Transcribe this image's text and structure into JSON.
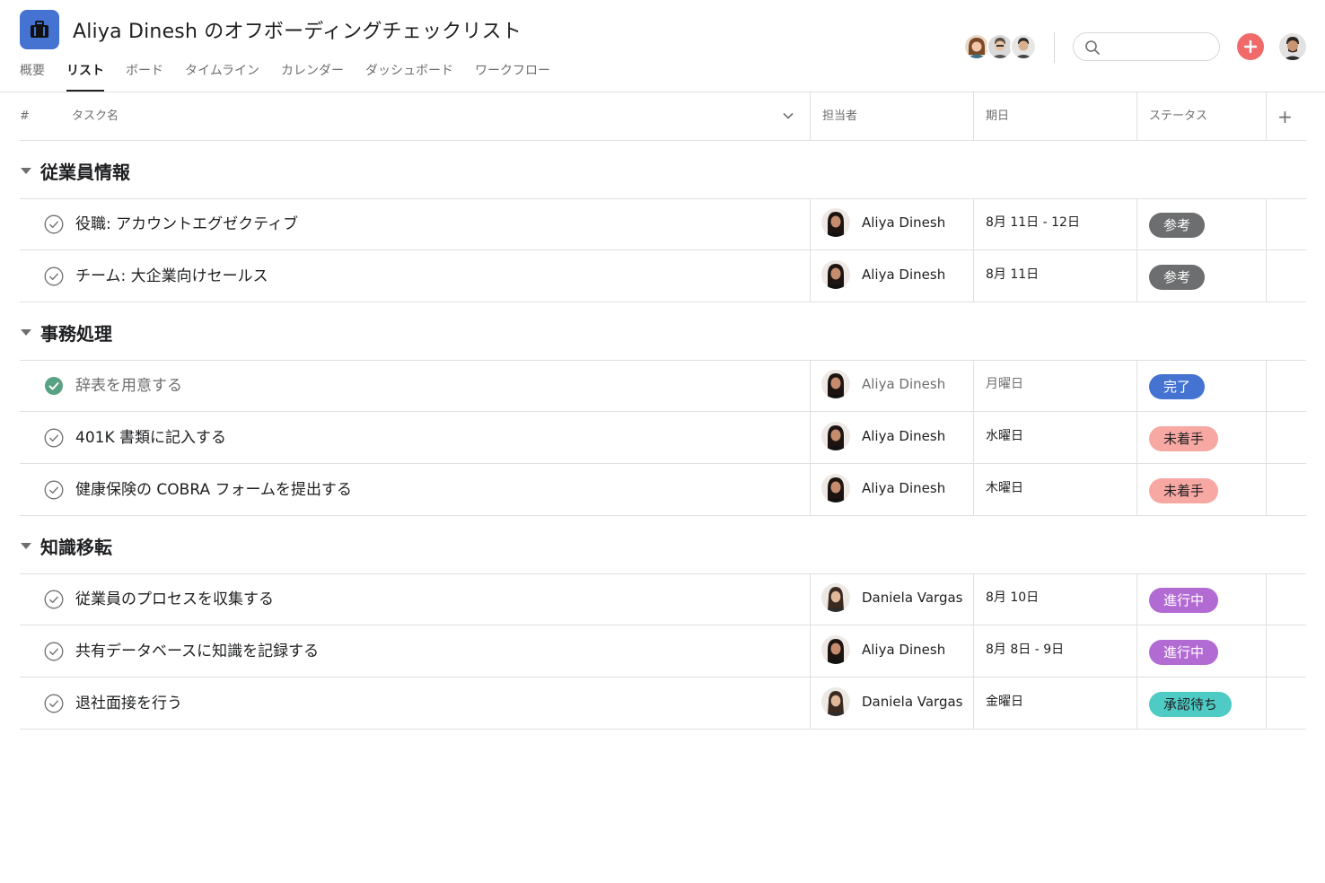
{
  "project": {
    "title": "Aliya Dinesh のオフボーディングチェックリスト",
    "icon": "briefcase-icon"
  },
  "tabs": [
    {
      "label": "概要",
      "active": false
    },
    {
      "label": "リスト",
      "active": true
    },
    {
      "label": "ボード",
      "active": false
    },
    {
      "label": "タイムライン",
      "active": false
    },
    {
      "label": "カレンダー",
      "active": false
    },
    {
      "label": "ダッシュボード",
      "active": false
    },
    {
      "label": "ワークフロー",
      "active": false
    }
  ],
  "header": {
    "search_placeholder": "",
    "add_icon": "plus-icon",
    "members_count": 3
  },
  "columns": {
    "index": "#",
    "task": "タスク名",
    "assignee": "担当者",
    "due": "期日",
    "status": "ステータス",
    "add": "+"
  },
  "sections": [
    {
      "title": "従業員情報",
      "tasks": [
        {
          "name": "役職: アカウントエグゼクティブ",
          "assignee": "Aliya Dinesh",
          "due": "8月 11日 - 12日",
          "status": "参考",
          "completed": false
        },
        {
          "name": "チーム: 大企業向けセールス",
          "assignee": "Aliya Dinesh",
          "due": "8月 11日",
          "status": "参考",
          "completed": false
        }
      ]
    },
    {
      "title": "事務処理",
      "tasks": [
        {
          "name": "辞表を用意する",
          "assignee": "Aliya Dinesh",
          "due": "月曜日",
          "status": "完了",
          "completed": true
        },
        {
          "name": "401K 書類に記入する",
          "assignee": "Aliya Dinesh",
          "due": "水曜日",
          "status": "未着手",
          "completed": false
        },
        {
          "name": "健康保険の COBRA フォームを提出する",
          "assignee": "Aliya Dinesh",
          "due": "木曜日",
          "status": "未着手",
          "completed": false
        }
      ]
    },
    {
      "title": "知識移転",
      "tasks": [
        {
          "name": "従業員のプロセスを収集する",
          "assignee": "Daniela Vargas",
          "due": "8月 10日",
          "status": "進行中",
          "completed": false
        },
        {
          "name": "共有データベースに知識を記録する",
          "assignee": "Aliya Dinesh",
          "due": "8月 8日 - 9日",
          "status": "進行中",
          "completed": false
        },
        {
          "name": "退社面接を行う",
          "assignee": "Daniela Vargas",
          "due": "金曜日",
          "status": "承認待ち",
          "completed": false
        }
      ]
    }
  ],
  "status_colors": {
    "参考": {
      "bg": "#6d6e6f",
      "fg": "#ffffff"
    },
    "完了": {
      "bg": "#4573d2",
      "fg": "#ffffff"
    },
    "未着手": {
      "bg": "#f8a8a3",
      "fg": "#1e1f21"
    },
    "進行中": {
      "bg": "#b36bd4",
      "fg": "#ffffff"
    },
    "承認待ち": {
      "bg": "#4ecbc4",
      "fg": "#1e1f21"
    }
  },
  "colors": {
    "accent": "#4573d2",
    "add_button": "#f06a6a",
    "check_done": "#58a182",
    "border": "#e0e0e0"
  }
}
